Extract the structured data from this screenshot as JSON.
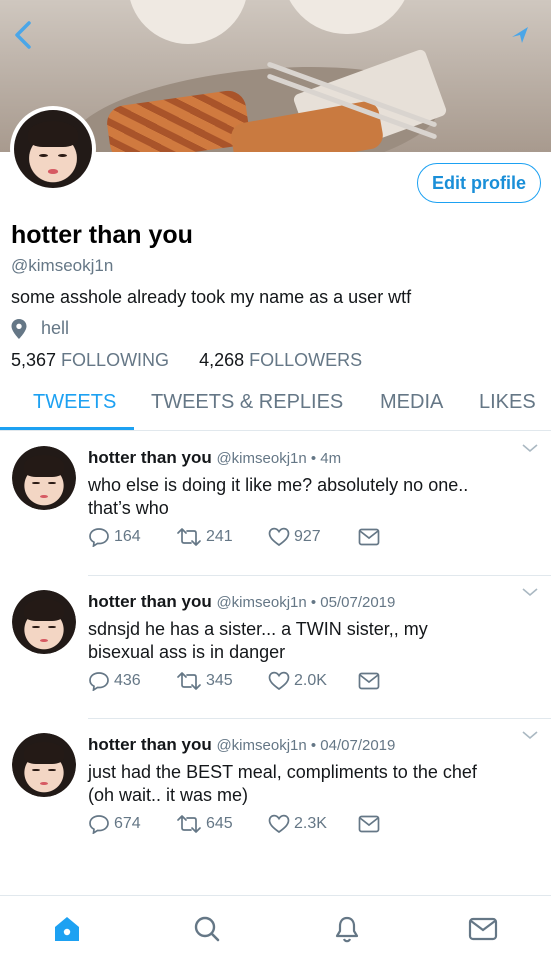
{
  "profile": {
    "display_name": "hotter than you",
    "handle": "@kimseokj1n",
    "bio": "some asshole already took my name as a user wtf",
    "location": "hell",
    "following_count": "5,367",
    "following_label": "FOLLOWING",
    "followers_count": "4,268",
    "followers_label": "FOLLOWERS",
    "edit_label": "Edit profile"
  },
  "tabs": [
    {
      "label": "TWEETS",
      "active": true
    },
    {
      "label": "TWEETS & REPLIES",
      "active": false
    },
    {
      "label": "MEDIA",
      "active": false
    },
    {
      "label": "LIKES",
      "active": false
    }
  ],
  "tweets": [
    {
      "name": "hotter than you",
      "meta": "@kimseokj1n • 4m",
      "text_line1": "who else is doing it like me? absolutely no one..",
      "text_line2": "that’s who",
      "replies": "164",
      "retweets": "241",
      "likes": "927"
    },
    {
      "name": "hotter than you",
      "meta": "@kimseokj1n • 05/07/2019",
      "text_line1": "sdnsjd he has a sister... a TWIN sister,, my",
      "text_line2": "bisexual ass is in danger",
      "replies": "436",
      "retweets": "345",
      "likes": "2.0K"
    },
    {
      "name": "hotter than you",
      "meta": "@kimseokj1n • 04/07/2019",
      "text_line1": "just had the BEST meal, compliments to the chef",
      "text_line2": "(oh wait.. it was me)",
      "replies": "674",
      "retweets": "645",
      "likes": "2.3K"
    }
  ],
  "icons": {
    "back": "back-chevron-icon",
    "share": "share-icon",
    "location": "location-pin-icon",
    "reply": "reply-icon",
    "retweet": "retweet-icon",
    "like": "heart-icon",
    "dm": "envelope-icon",
    "home": "home-icon",
    "search": "search-icon",
    "notifications": "bell-icon",
    "messages": "mail-icon"
  },
  "colors": {
    "accent": "#1da1f2",
    "secondary_text": "#657786",
    "primary_text": "#14171a"
  }
}
